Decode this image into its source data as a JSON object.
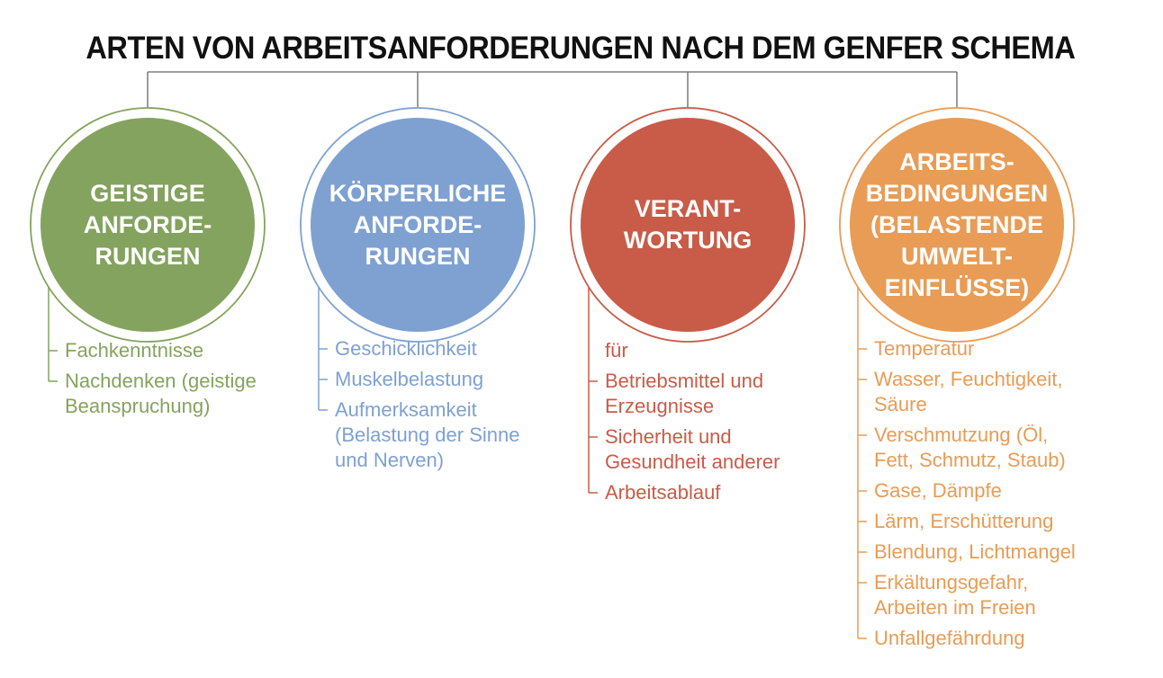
{
  "title": "ARTEN VON ARBEITSANFORDERUNGEN NACH DEM GENFER SCHEMA",
  "columns": [
    {
      "color": "#84a35f",
      "ring": "#84a35f",
      "label": [
        "GEISTIGE",
        "ANFORDE-",
        "RUNGEN"
      ],
      "intro": "",
      "items": [
        [
          "Fachkenntnisse"
        ],
        [
          "Nachdenken (geistige",
          "Beanspruchung)"
        ]
      ]
    },
    {
      "color": "#7ea1d2",
      "ring": "#7ea1d2",
      "label": [
        "KÖRPERLICHE",
        "ANFORDE-",
        "RUNGEN"
      ],
      "intro": "",
      "items": [
        [
          "Geschicklichkeit"
        ],
        [
          "Muskelbelastung"
        ],
        [
          "Aufmerksamkeit",
          "(Belastung der Sinne",
          " und Nerven)"
        ]
      ]
    },
    {
      "color": "#c85c48",
      "ring": "#c85c48",
      "label": [
        "VERANT-",
        "WORTUNG"
      ],
      "intro": "für",
      "items": [
        [
          "Betriebsmittel und",
          "Erzeugnisse"
        ],
        [
          "Sicherheit und",
          "Gesundheit anderer"
        ],
        [
          "Arbeitsablauf"
        ]
      ]
    },
    {
      "color": "#e89c55",
      "ring": "#e89c55",
      "label": [
        "ARBEITS-",
        "BEDINGUNGEN",
        "(BELASTENDE",
        "UMWELT-",
        "EINFLÜSSE)"
      ],
      "intro": "",
      "items": [
        [
          "Temperatur"
        ],
        [
          "Wasser, Feuchtigkeit,",
          "Säure"
        ],
        [
          "Verschmutzung (Öl,",
          "Fett, Schmutz, Staub)"
        ],
        [
          "Gase, Dämpfe"
        ],
        [
          "Lärm, Erschütterung"
        ],
        [
          "Blendung, Lichtmangel"
        ],
        [
          "Erkältungsgefahr,",
          "Arbeiten im Freien"
        ],
        [
          "Unfallgefährdung"
        ]
      ]
    }
  ]
}
